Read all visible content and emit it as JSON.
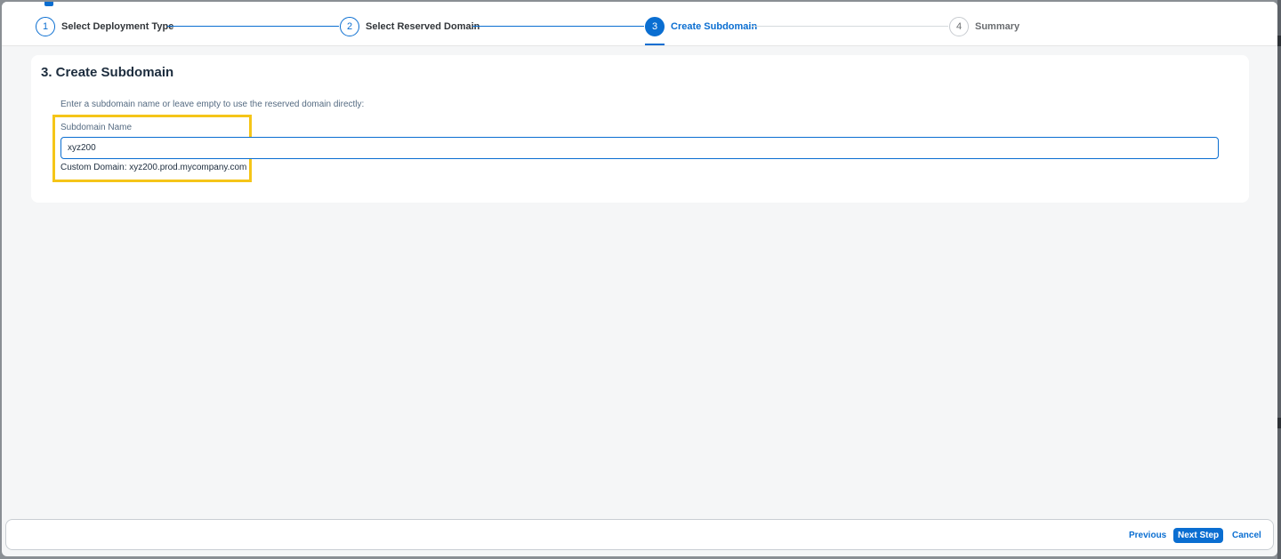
{
  "wizard": {
    "steps": [
      {
        "number": "1",
        "label": "Select Deployment Type",
        "state": "done"
      },
      {
        "number": "2",
        "label": "Select Reserved Domain",
        "state": "done"
      },
      {
        "number": "3",
        "label": "Create Subdomain",
        "state": "active"
      },
      {
        "number": "4",
        "label": "Summary",
        "state": "future"
      }
    ]
  },
  "main": {
    "title": "3. Create Subdomain",
    "instruction": "Enter a subdomain name or leave empty to use the reserved domain directly:",
    "field_label": "Subdomain Name",
    "subdomain_value": "xyz200",
    "custom_domain_text": "Custom Domain: xyz200.prod.mycompany.com"
  },
  "footer": {
    "previous_label": "Previous",
    "next_label": "Next Step",
    "cancel_label": "Cancel"
  },
  "colors": {
    "accent": "#0a6ed1",
    "highlight": "#f5c518"
  }
}
